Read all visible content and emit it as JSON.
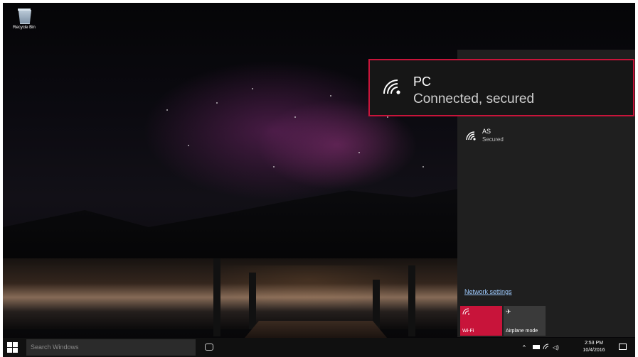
{
  "desktop": {
    "recycle_bin_label": "Recycle Bin"
  },
  "network_flyout": {
    "connected_network": {
      "ssid": "PC",
      "status": "Connected, secured",
      "icon": "wifi-signal-icon",
      "highlight_color": "#c8143a"
    },
    "networks": [
      {
        "ssid": "AS",
        "status": "Secured",
        "icon": "wifi-signal-icon"
      }
    ],
    "settings_link": "Network settings",
    "quick_actions": [
      {
        "label": "Wi-Fi",
        "icon": "wifi-icon",
        "active": true,
        "color": "#c8143a"
      },
      {
        "label": "Airplane mode",
        "icon": "airplane-icon",
        "active": false,
        "color": "#3a3a3a"
      }
    ]
  },
  "taskbar": {
    "search_placeholder": "Search Windows",
    "time": "2:53 PM",
    "date": "10/4/2016",
    "tray_icons": [
      "chevron-up-icon",
      "battery-icon",
      "network-icon",
      "volume-icon"
    ],
    "action_center_icon": "action-center-icon"
  }
}
